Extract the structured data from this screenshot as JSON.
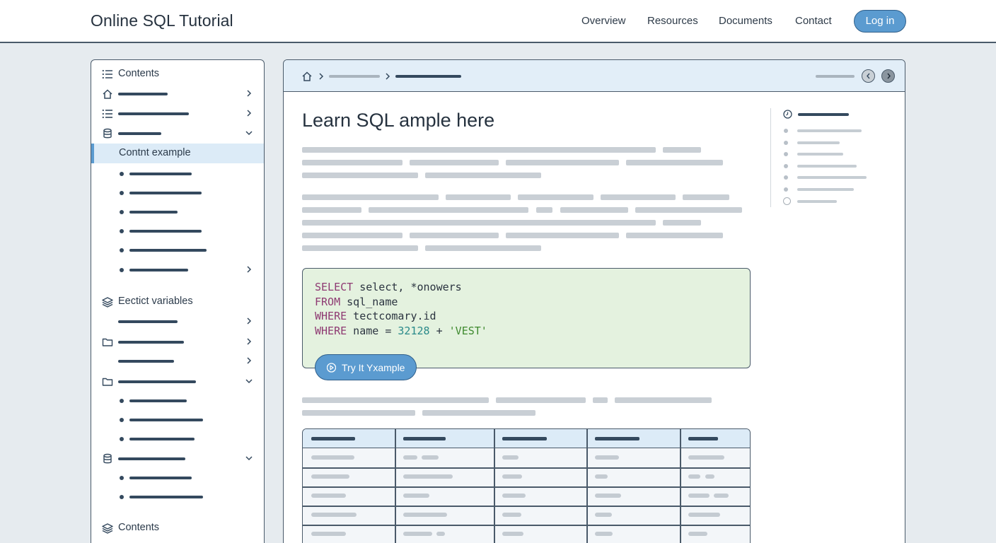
{
  "header": {
    "brand": "Online SQL Tutorial",
    "nav": [
      "Overview",
      "Resources",
      "Documents",
      "Contact"
    ],
    "login_label": "Log in"
  },
  "sidebar": {
    "section1_title": "Contents",
    "active_item": "Contnt example",
    "section2_title": "Eectict variables",
    "section3_title": "Contents"
  },
  "main": {
    "title": "Learn SQL ample here",
    "code_lines": [
      {
        "kw": "SELECT",
        "rest": " select, *onowers"
      },
      {
        "kw": "FROM",
        "rest": " sql_name"
      },
      {
        "kw": "WHERE",
        "rest": " tectcomary.id"
      },
      {
        "kw": "WHERE",
        "rest": " name = ",
        "num": "32128",
        "op": " + ",
        "str": "'VEST'"
      }
    ],
    "try_label": "Try It Yxample"
  },
  "colors": {
    "accent": "#5b9bd0",
    "border": "#4a5a6a",
    "code_bg": "#e4f2df",
    "header_row_bg": "#dcebf7"
  },
  "icons": {
    "home": "home-icon",
    "list": "list-icon",
    "database": "database-icon",
    "layers": "layers-icon",
    "folder": "folder-icon",
    "chevron_right": "chevron-right-icon",
    "chevron_down": "chevron-down-icon",
    "play": "play-icon",
    "clock": "clock-icon"
  }
}
